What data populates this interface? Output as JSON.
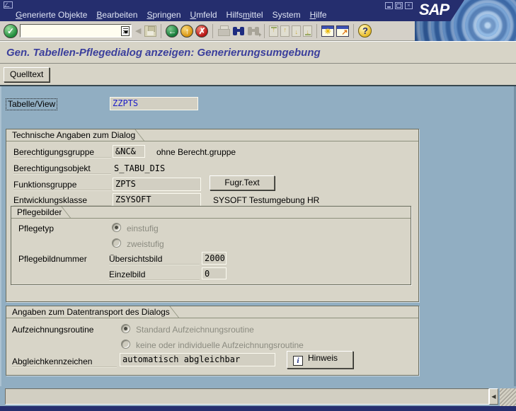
{
  "colors": {
    "navy": "#252e6e",
    "client_background": "#91aec2",
    "panel_background": "#d8d5c8",
    "toolbar_background": "#d4d0c8",
    "title_text": "#3b3f9c",
    "field_value_blue": "#1a1ac8"
  },
  "titlebar": {
    "logo_text": "SAP"
  },
  "menu": {
    "items": [
      {
        "pre": "",
        "key": "G",
        "post": "enerierte Objekte"
      },
      {
        "pre": "",
        "key": "B",
        "post": "earbeiten"
      },
      {
        "pre": "",
        "key": "S",
        "post": "pringen"
      },
      {
        "pre": "",
        "key": "U",
        "post": "mfeld"
      },
      {
        "pre": "Hilfs",
        "key": "m",
        "post": "ittel"
      },
      {
        "pre": "System",
        "key": "",
        "post": ""
      },
      {
        "pre": "",
        "key": "H",
        "post": "ilfe"
      }
    ]
  },
  "toolbar": {
    "command_value": "",
    "buttons": [
      "enter",
      "save",
      "back",
      "exit",
      "cancel",
      "print",
      "find",
      "find-next",
      "first-page",
      "previous-page",
      "next-page",
      "last-page",
      "new-session",
      "create-shortcut",
      "help"
    ]
  },
  "glyphs": {
    "enter": "✓",
    "back": "←",
    "exit": "↑",
    "cancel": "✗",
    "collapse": "◀",
    "help": "?",
    "info": "i",
    "page_up": "↑",
    "page_down": "↓",
    "session_star": "✳",
    "shortcut_arrow": "↗",
    "status_collapse": "◀"
  },
  "screen": {
    "title": "Gen. Tabellen-Pflegedialog anzeigen: Generierungsumgebung",
    "app_toolbar": {
      "source_button": "Quelltext"
    },
    "tabelle_view": {
      "label": "Tabelle/View",
      "value": "ZZPTS"
    },
    "group_technical": {
      "title": "Technische Angaben zum Dialog",
      "auth_group": {
        "label": "Berechtigungsgruppe",
        "value": "&NC&",
        "description": "ohne Berecht.gruppe"
      },
      "auth_object": {
        "label": "Berechtigungsobjekt",
        "value": "S_TABU_DIS"
      },
      "function_group": {
        "label": "Funktionsgruppe",
        "value": "ZPTS",
        "button": "Fugr.Text"
      },
      "dev_class": {
        "label": "Entwicklungsklasse",
        "value": "ZSYSOFT",
        "description": "SYSOFT Testumgebung HR"
      },
      "maintenance_screens": {
        "title": "Pflegebilder",
        "type": {
          "label": "Pflegetyp",
          "options": [
            {
              "label": "einstufig",
              "selected": true
            },
            {
              "label": "zweistufig",
              "selected": false
            }
          ]
        },
        "screen_numbers": {
          "label": "Pflegebildnummer",
          "overview": {
            "label": "Übersichtsbild",
            "value": "2000"
          },
          "single": {
            "label": "Einzelbild",
            "value": "0"
          }
        }
      }
    },
    "group_transport": {
      "title": "Angaben zum Datentransport des Dialogs",
      "recording_routine": {
        "label": "Aufzeichnungsroutine",
        "options": [
          {
            "label": "Standard Aufzeichnungsroutine",
            "selected": true
          },
          {
            "label": "keine oder individuelle Aufzeichnungsroutine",
            "selected": false
          }
        ]
      },
      "adjustment_flag": {
        "label": "Abgleichkennzeichen",
        "value": "automatisch abgleichbar",
        "button": "Hinweis"
      }
    },
    "statusbar": {
      "message": ""
    }
  }
}
